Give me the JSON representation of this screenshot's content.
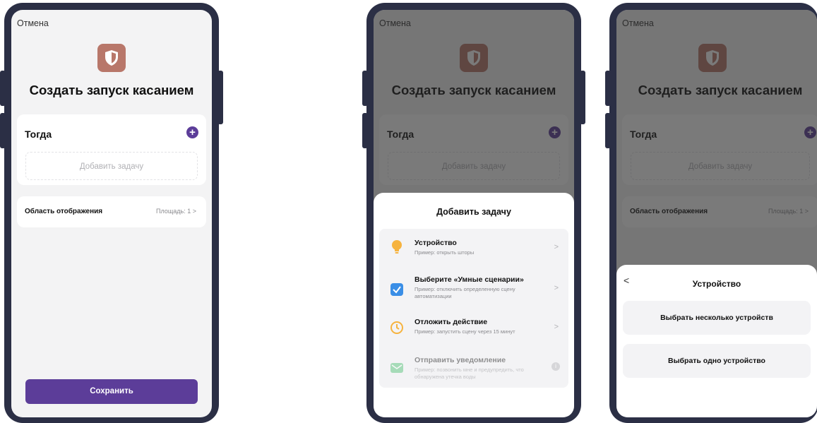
{
  "create_screen": {
    "cancel": "Отмена",
    "title": "Создать запуск касанием",
    "then_label": "Тогда",
    "add_task_placeholder": "Добавить задачу",
    "area_label": "Область отображения",
    "area_value": "Площадь: 1",
    "save_label": "Сохранить"
  },
  "add_task_sheet": {
    "title": "Добавить задачу",
    "items": [
      {
        "title": "Устройство",
        "desc": "Пример: открыть шторы",
        "icon": "lightbulb-icon"
      },
      {
        "title": "Выберите «Умные сценарии»",
        "desc": "Пример: отключить определенную сцену автоматизации",
        "icon": "checkbox-icon"
      },
      {
        "title": "Отложить действие",
        "desc": "Пример: запустить сцену через 15 минут",
        "icon": "clock-icon"
      },
      {
        "title": "Отправить уведомление",
        "desc": "Пример: позвонить мне и предупредить, что обнаружена утечка воды",
        "icon": "message-icon"
      }
    ]
  },
  "device_sheet": {
    "title": "Устройство",
    "multiple": "Выбрать несколько устройств",
    "single": "Выбрать одно устройство"
  },
  "colors": {
    "accent": "#5c3d99",
    "shield": "#b8776a",
    "frame": "#2b2f45"
  }
}
